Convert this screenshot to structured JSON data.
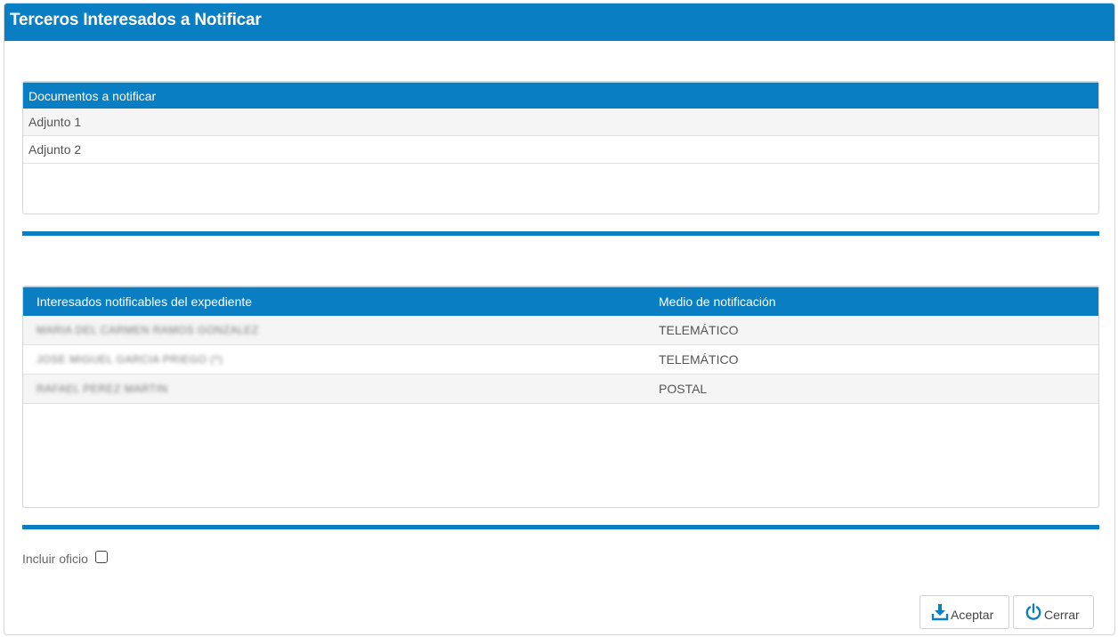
{
  "dialog": {
    "title": "Terceros Interesados a Notificar"
  },
  "documents": {
    "header": "Documentos a notificar",
    "items": [
      "Adjunto 1",
      "Adjunto 2"
    ]
  },
  "interested": {
    "col_name": "Interesados notificables del expediente",
    "col_medium": "Medio de notificación",
    "rows": [
      {
        "name": "MARIA DEL CARMEN RAMOS GONZALEZ",
        "medium": "TELEMÁTICO"
      },
      {
        "name": "JOSE MIGUEL GARCIA PRIEGO (*)",
        "medium": "TELEMÁTICO"
      },
      {
        "name": "RAFAEL PEREZ MARTIN",
        "medium": "POSTAL"
      }
    ]
  },
  "options": {
    "incluir_oficio_label": "Incluir oficio",
    "incluir_oficio_checked": false
  },
  "buttons": {
    "accept_label": "Aceptar",
    "accept_icon": "download-icon",
    "close_label": "Cerrar",
    "close_icon": "power-icon"
  },
  "colors": {
    "primary": "#0a7ec2"
  }
}
